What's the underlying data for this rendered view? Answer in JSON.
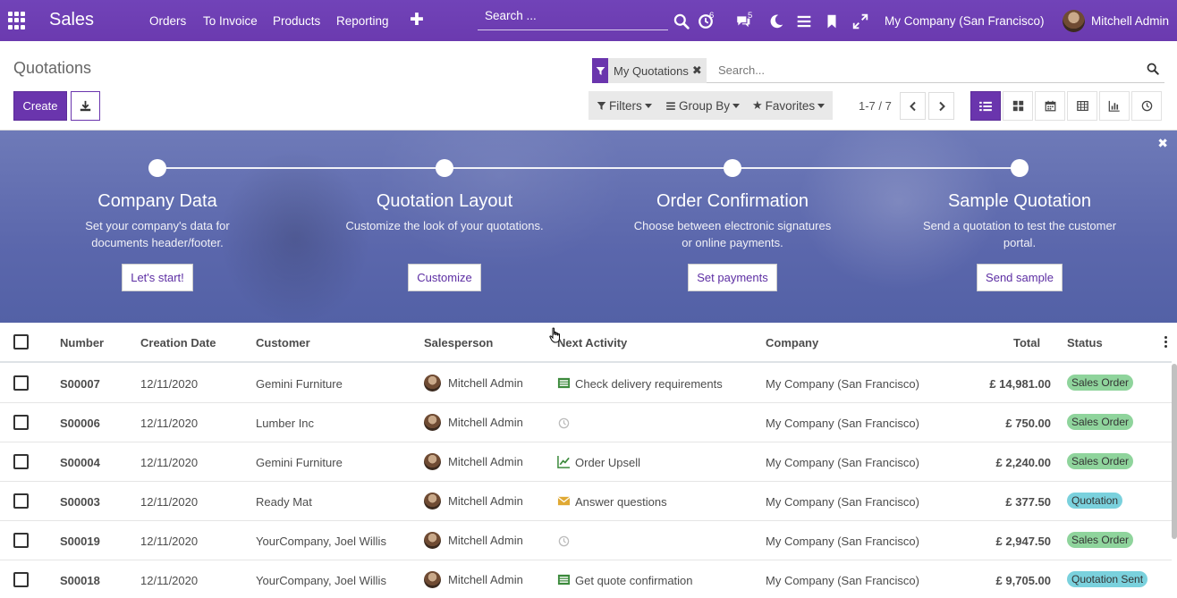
{
  "navbar": {
    "brand": "Sales",
    "menu": [
      "Orders",
      "To Invoice",
      "Products",
      "Reporting"
    ],
    "search_placeholder": "Search ...",
    "activity_count": "6",
    "message_count": "5",
    "company": "My Company (San Francisco)",
    "user": "Mitchell Admin"
  },
  "control": {
    "breadcrumb": "Quotations",
    "create_label": "Create",
    "facet_label": "My Quotations",
    "search_placeholder": "Search...",
    "filters_label": "Filters",
    "groupby_label": "Group By",
    "favorites_label": "Favorites",
    "pager": "1-7 / 7"
  },
  "banner": {
    "steps": [
      {
        "title": "Company Data",
        "desc": "Set your company's data for documents header/footer.",
        "button": "Let's start!"
      },
      {
        "title": "Quotation Layout",
        "desc": "Customize the look of your quotations.",
        "button": "Customize"
      },
      {
        "title": "Order Confirmation",
        "desc": "Choose between electronic signatures or online payments.",
        "button": "Set payments"
      },
      {
        "title": "Sample Quotation",
        "desc": "Send a quotation to test the customer portal.",
        "button": "Send sample"
      }
    ]
  },
  "table": {
    "headers": {
      "number": "Number",
      "date": "Creation Date",
      "customer": "Customer",
      "salesperson": "Salesperson",
      "activity": "Next Activity",
      "company": "Company",
      "total": "Total",
      "status": "Status"
    },
    "rows": [
      {
        "number": "S00007",
        "date": "12/11/2020",
        "customer": "Gemini Furniture",
        "salesperson": "Mitchell Admin",
        "activity": "Check delivery requirements",
        "activity_icon": "list-icon",
        "company": "My Company (San Francisco)",
        "total": "£ 14,981.00",
        "status": "Sales Order"
      },
      {
        "number": "S00006",
        "date": "12/11/2020",
        "customer": "Lumber Inc",
        "salesperson": "Mitchell Admin",
        "activity": "",
        "activity_icon": "clock-icon",
        "company": "My Company (San Francisco)",
        "total": "£ 750.00",
        "status": "Sales Order"
      },
      {
        "number": "S00004",
        "date": "12/11/2020",
        "customer": "Gemini Furniture",
        "salesperson": "Mitchell Admin",
        "activity": "Order Upsell",
        "activity_icon": "chart-line-icon",
        "company": "My Company (San Francisco)",
        "total": "£ 2,240.00",
        "status": "Sales Order"
      },
      {
        "number": "S00003",
        "date": "12/11/2020",
        "customer": "Ready Mat",
        "salesperson": "Mitchell Admin",
        "activity": "Answer questions",
        "activity_icon": "envelope-icon",
        "company": "My Company (San Francisco)",
        "total": "£ 377.50",
        "status": "Quotation"
      },
      {
        "number": "S00019",
        "date": "12/11/2020",
        "customer": "YourCompany, Joel Willis",
        "salesperson": "Mitchell Admin",
        "activity": "",
        "activity_icon": "clock-icon",
        "company": "My Company (San Francisco)",
        "total": "£ 2,947.50",
        "status": "Sales Order"
      },
      {
        "number": "S00018",
        "date": "12/11/2020",
        "customer": "YourCompany, Joel Willis",
        "salesperson": "Mitchell Admin",
        "activity": "Get quote confirmation",
        "activity_icon": "list-icon",
        "company": "My Company (San Francisco)",
        "total": "£ 9,705.00",
        "status": "Quotation Sent"
      }
    ]
  },
  "colors": {
    "brand": "#6d3bb5",
    "sales_order_badge": "#8fd49c",
    "quotation_badge": "#7ad1dd",
    "quotation_sent_badge": "#7ad1dd"
  }
}
